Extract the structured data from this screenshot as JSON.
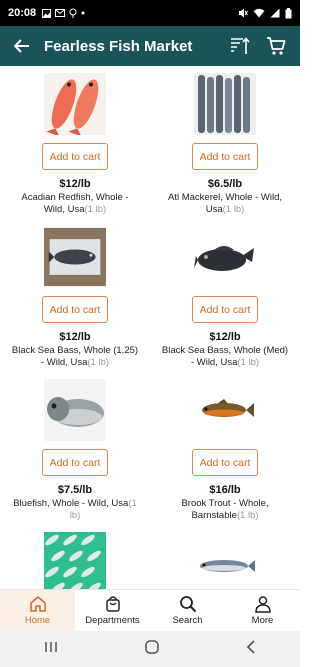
{
  "status_bar": {
    "time": "20:08"
  },
  "app_bar": {
    "title": "Fearless Fish Market"
  },
  "products": [
    {
      "price": "$12/lb",
      "name": "Acadian Redfish, Whole - Wild, Usa",
      "unit": "(1 lb)",
      "button": "Add to cart",
      "image": "redfish"
    },
    {
      "price": "$6.5/lb",
      "name": "Atl Mackerel, Whole - Wild, Usa",
      "unit": "(1 lb)",
      "button": "Add to cart",
      "image": "mackerel"
    },
    {
      "price": "$12/lb",
      "name": "Black Sea Bass, Whole (1.25) - Wild, Usa",
      "unit": "(1 lb)",
      "button": "Add to cart",
      "image": "sea-bass-tray"
    },
    {
      "price": "$12/lb",
      "name": "Black Sea Bass, Whole (Med) - Wild, Usa",
      "unit": "(1 lb)",
      "button": "Add to cart",
      "image": "sea-bass"
    },
    {
      "price": "$7.5/lb",
      "name": "Bluefish, Whole - Wild, Usa",
      "unit": "(1 lb)",
      "button": "Add to cart",
      "image": "bluefish"
    },
    {
      "price": "$16/lb",
      "name": "Brook Trout - Whole, Barnstable",
      "unit": "(1 lb)",
      "button": "Add to cart",
      "image": "brook-trout"
    },
    {
      "image": "fish-rows"
    },
    {
      "image": "mackerel-single"
    }
  ],
  "bottom_nav": [
    {
      "label": "Home",
      "icon": "home-icon",
      "active": true
    },
    {
      "label": "Departments",
      "icon": "bag-icon",
      "active": false
    },
    {
      "label": "Search",
      "icon": "search-icon",
      "active": false
    },
    {
      "label": "More",
      "icon": "person-icon",
      "active": false
    }
  ],
  "colors": {
    "app_bar": "#1a5458",
    "accent": "#d2691e",
    "active_tab_bg": "#fbf0e6"
  }
}
